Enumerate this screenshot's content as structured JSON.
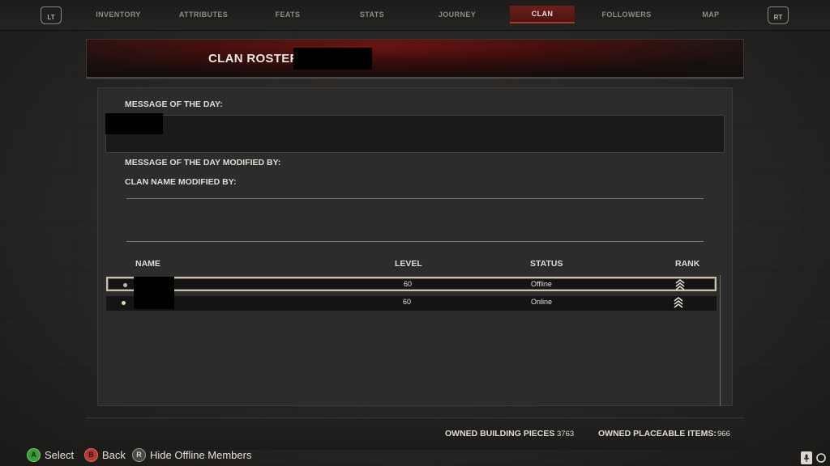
{
  "nav": {
    "left_bumper": "LT",
    "right_bumper": "RT",
    "tabs": [
      {
        "label": "INVENTORY"
      },
      {
        "label": "ATTRIBUTES"
      },
      {
        "label": "FEATS"
      },
      {
        "label": "STATS"
      },
      {
        "label": "JOURNEY"
      },
      {
        "label": "CLAN",
        "active": true
      },
      {
        "label": "FOLLOWERS"
      },
      {
        "label": "MAP"
      }
    ]
  },
  "header": {
    "title": "CLAN ROSTER"
  },
  "clan_info": {
    "motd_label": "MESSAGE OF THE DAY:",
    "motd_modified_label": "MESSAGE OF THE DAY MODIFIED BY:",
    "clan_name_modified_label": "CLAN NAME MODIFIED BY:"
  },
  "roster": {
    "columns": [
      "NAME",
      "LEVEL",
      "STATUS",
      "RANK"
    ],
    "rows": [
      {
        "level": "60",
        "status": "Offline",
        "selected": true,
        "rank_icon": "rank-chevrons-icon"
      },
      {
        "level": "60",
        "status": "Online",
        "selected": false,
        "rank_icon": "rank-chevrons-icon"
      }
    ]
  },
  "footer": {
    "building_pieces_label": "OWNED BUILDING PIECES",
    "building_pieces_value": "3763",
    "placeable_items_label": "OWNED PLACEABLE ITEMS:",
    "placeable_items_value": "966"
  },
  "hints": [
    {
      "button": "A",
      "label": "Select"
    },
    {
      "button": "B",
      "label": "Back"
    },
    {
      "button": "R",
      "label": "Hide Offline Members"
    }
  ],
  "colors": {
    "accent_red": "#6d1e1a",
    "selection_border": "#cbbfa6",
    "online_dot": "#e8d9a0"
  }
}
